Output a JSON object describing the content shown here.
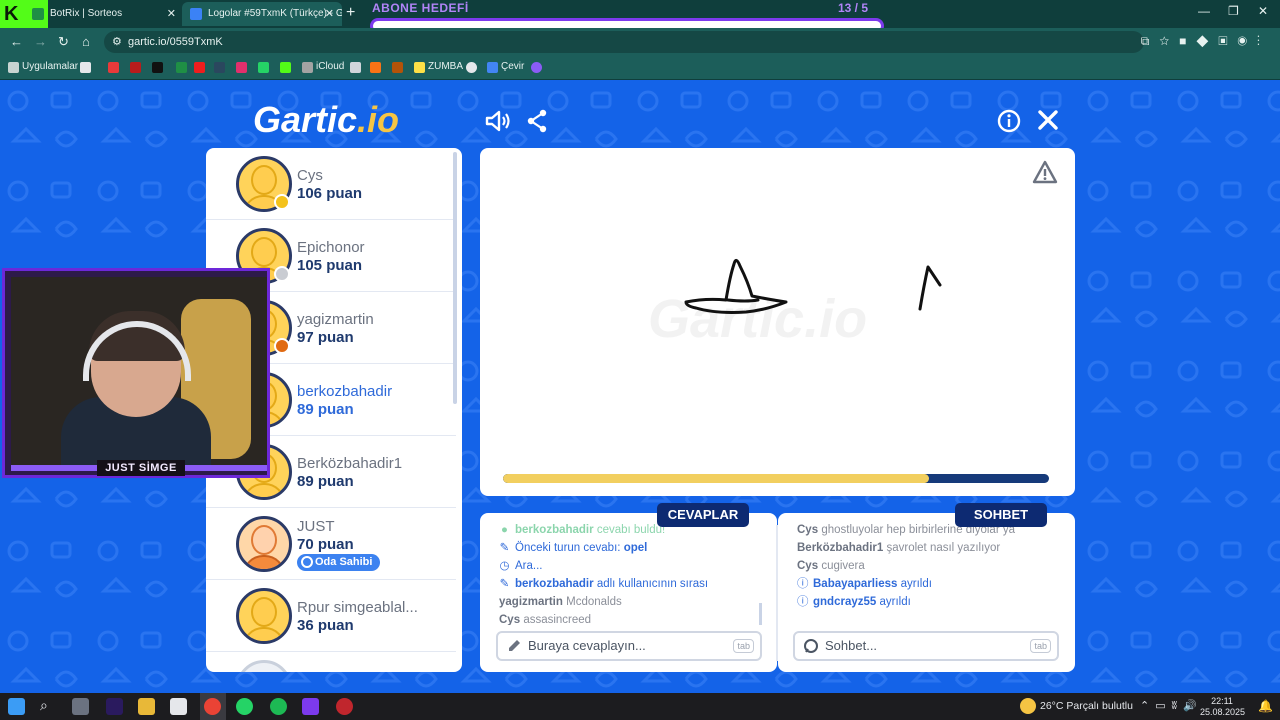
{
  "browser": {
    "tabs": [
      {
        "title": "BotRix | Sorteos",
        "active": false
      },
      {
        "title": "Logolar #59TxmK (Türkçe) - Gar",
        "active": true
      }
    ],
    "url": "gartic.io/0559TxmK",
    "bookmarks": [
      {
        "label": "Uygulamalar"
      },
      {
        "label": "iCloud"
      },
      {
        "label": "ZUMBA"
      },
      {
        "label": "Çevir"
      }
    ]
  },
  "overlay": {
    "goal_title": "ABONE HEDEFİ",
    "goal_count": "13 / 5",
    "webcam_name": "JUST SİMGE"
  },
  "game": {
    "logo_main": "Gartic",
    "logo_suffix": ".io",
    "players": [
      {
        "name": "Cys",
        "points": "106 puan",
        "status_color": "#f4c21b",
        "active": false
      },
      {
        "name": "Epichonor",
        "points": "105 puan",
        "status_color": "#c9ccd2",
        "active": false
      },
      {
        "name": "yagizmartin",
        "points": "97 puan",
        "status_color": "#e06a12",
        "active": false
      },
      {
        "name": "berkozbahadir",
        "points": "89 puan",
        "status_color": "",
        "active": true
      },
      {
        "name": "Berközbahadir1",
        "points": "89 puan",
        "status_color": "",
        "active": false
      },
      {
        "name": "JUST",
        "points": "70 puan",
        "badge": "Oda Sahibi",
        "status_color": "",
        "active": false
      },
      {
        "name": "Rpur simgeablal...",
        "points": "36 puan",
        "status_color": "",
        "active": false
      }
    ],
    "timer_progress": 0.78,
    "answers": {
      "title": "CEVAPLAR",
      "messages": [
        {
          "kind": "green",
          "user": "berkozbahadir",
          "text": "cevabı buldu!"
        },
        {
          "kind": "sys",
          "pre": "Önceki turun cevabı:",
          "user": "opel",
          "text": ""
        },
        {
          "kind": "sys",
          "pre": "Ara...",
          "user": "",
          "text": ""
        },
        {
          "kind": "sys",
          "pre": "",
          "user": "berkozbahadir",
          "text": "adlı kullanıcının sırası"
        },
        {
          "kind": "plain",
          "user": "yagizmartin",
          "text": "Mcdonalds"
        },
        {
          "kind": "plain",
          "user": "Cys",
          "text": "assasincreed"
        }
      ],
      "placeholder": "Buraya cevaplayın...",
      "key_hint": "tab"
    },
    "chat": {
      "title": "SOHBET",
      "messages": [
        {
          "kind": "plain",
          "user": "Cys",
          "text": "ghostluyolar hep birbirlerine diyolar ya"
        },
        {
          "kind": "plain",
          "user": "Berközbahadir1",
          "text": "şavrolet nasıl yazılıyor"
        },
        {
          "kind": "plain",
          "user": "Cys",
          "text": "cugivera"
        },
        {
          "kind": "sysinfo",
          "user": "Babayaparliess",
          "text": "ayrıldı"
        },
        {
          "kind": "sysinfo",
          "user": "gndcrayz55",
          "text": "ayrıldı"
        }
      ],
      "placeholder": "Sohbet...",
      "key_hint": "tab"
    }
  },
  "taskbar": {
    "weather": "26°C  Parçalı bulutlu",
    "time": "22:11",
    "date": "25.08.2025"
  }
}
